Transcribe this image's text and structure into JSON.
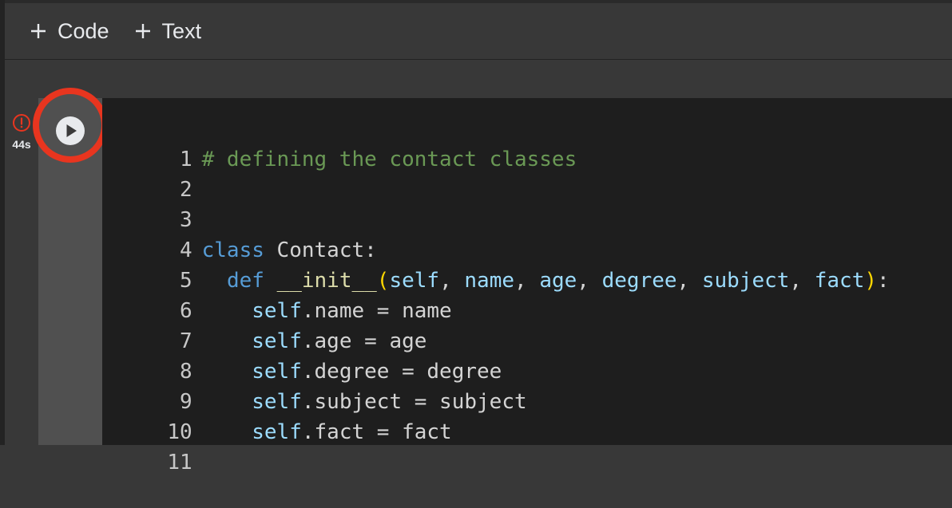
{
  "toolbar": {
    "code_label": "Code",
    "text_label": "Text"
  },
  "cell": {
    "exec_time": "44s",
    "status": "error",
    "lines": [
      {
        "n": "1",
        "text": "# defining the contact classes"
      },
      {
        "n": "2",
        "text": ""
      },
      {
        "n": "3",
        "text": ""
      },
      {
        "n": "4",
        "text": "class Contact:"
      },
      {
        "n": "5",
        "text": "  def __init__(self, name, age, degree, subject, fact):"
      },
      {
        "n": "6",
        "text": "    self.name = name"
      },
      {
        "n": "7",
        "text": "    self.age = age"
      },
      {
        "n": "8",
        "text": "    self.degree = degree"
      },
      {
        "n": "9",
        "text": "    self.subject = subject"
      },
      {
        "n": "10",
        "text": "    self.fact = fact"
      },
      {
        "n": "11",
        "text": ""
      }
    ]
  },
  "colors": {
    "highlight": "#e8351f",
    "error": "#e8351f",
    "comment": "#6a9955",
    "keyword": "#569cd6"
  },
  "icons": {
    "run": "play-circle-icon",
    "error": "error-circle-icon",
    "add": "plus-icon"
  }
}
